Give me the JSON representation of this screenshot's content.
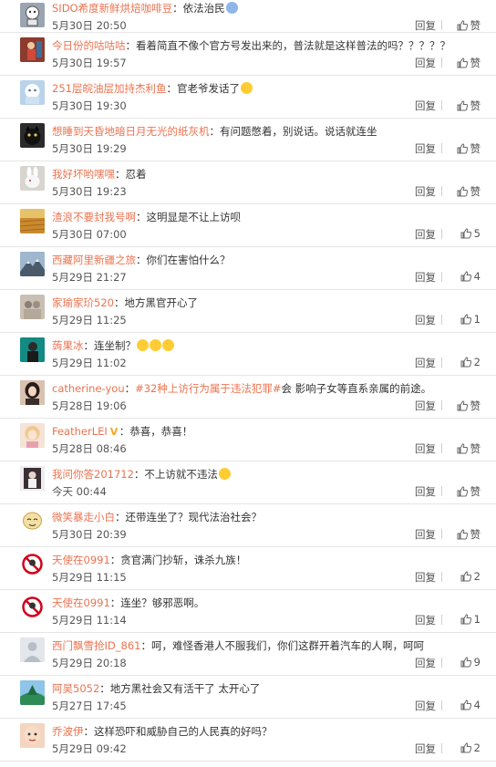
{
  "ui": {
    "reply_label": "回复",
    "like_default_label": "赞"
  },
  "comments": [
    {
      "user": "SIDO希度新鲜烘焙咖啡豆",
      "sep": "：",
      "text": "依法治民",
      "emoji": "sad",
      "time": "5月30日 20:50",
      "likes": "赞",
      "avatar": "#9aa5b1",
      "avatar_icon": "robot"
    },
    {
      "user": "今日份的咕咕咕",
      "sep": "：",
      "text": "看着简直不像个官方号发出来的，普法就是这样普法的吗？？？？？",
      "time": "5月30日 19:57",
      "likes": "赞",
      "avatar": "#c0392b",
      "avatar_icon": "figure"
    },
    {
      "user": "251层皖油层加持杰利鱼",
      "sep": "：",
      "text": "官老爷发话了",
      "emoji": "grin",
      "time": "5月30日 19:30",
      "likes": "赞",
      "avatar": "#b9d3ea",
      "avatar_icon": "ghost"
    },
    {
      "user": "想睡到天昏地暗日月无光的纸灰机",
      "sep": "：",
      "text": "有问题憋着，别说话。说话就连坐",
      "time": "5月30日 19:29",
      "likes": "赞",
      "avatar": "#2b2b2b",
      "avatar_icon": "cat"
    },
    {
      "user": "我好坏哟嘿嘿",
      "sep": "：",
      "text": "忍着",
      "time": "5月30日 19:23",
      "likes": "赞",
      "avatar": "#d8d4cf",
      "avatar_icon": "rabbit"
    },
    {
      "user": "渣浪不要封我号啊",
      "sep": "：",
      "text": "这明显是不让上访呗",
      "time": "5月30日 07:00",
      "likes": "5",
      "avatar": "#d9a441",
      "avatar_icon": "field"
    },
    {
      "user": "西藏阿里新疆之旅",
      "sep": "：",
      "text": "你们在害怕什么？",
      "time": "5月29日 21:27",
      "likes": "4",
      "avatar": "#6f8fb3",
      "avatar_icon": "mountain"
    },
    {
      "user": "家瑜家玠520",
      "sep": "：",
      "text": "地方黑官开心了",
      "time": "5月29日 11:25",
      "likes": "1",
      "avatar": "#c9bfb3",
      "avatar_icon": "people"
    },
    {
      "user": "蒟果冰",
      "sep": "：",
      "text": "连坐制？",
      "emoji3": true,
      "time": "5月29日 11:02",
      "likes": "2",
      "avatar": "#1f7f7a",
      "avatar_icon": "man"
    },
    {
      "user": "catherine-you",
      "sep": "：",
      "tag": "#32种上访行为属于违法犯罪#",
      "text": "会 影响子女等直系亲属的前途。",
      "time": "5月28日 19:06",
      "likes": "赞",
      "avatar": "#3a2e2a",
      "avatar_icon": "woman"
    },
    {
      "user": "FeatherLEI",
      "vip": true,
      "sep": "：",
      "text": "恭喜，恭喜！",
      "time": "5月28日 08:46",
      "likes": "赞",
      "avatar": "#e8c9b0",
      "avatar_icon": "girl"
    },
    {
      "user": "我问你答201712",
      "sep": "：",
      "text": "不上访就不违法",
      "emoji": "grin",
      "time": "今天 00:44",
      "likes": "赞",
      "avatar": "#5a4a55",
      "avatar_icon": "figure2"
    },
    {
      "user": "微笑暴走小白",
      "sep": "：",
      "text": "还带连坐了？现代法治社会？",
      "time": "5月30日 20:39",
      "likes": "赞",
      "avatar": "#f3e2a6",
      "avatar_icon": "cartoon"
    },
    {
      "user": "天使在0991",
      "sep": "：",
      "text": "贪官满门抄斩，诛杀九族！",
      "time": "5月29日 11:15",
      "likes": "2",
      "avatar": "#ffffff",
      "avatar_icon": "nosign"
    },
    {
      "user": "天使在0991",
      "sep": "：",
      "text": "连坐？够邪恶啊。",
      "time": "5月29日 11:14",
      "likes": "1",
      "avatar": "#ffffff",
      "avatar_icon": "nosign"
    },
    {
      "user": "西门飘雪抢ID_861",
      "sep": "：",
      "text": "呵，难怪香港人不服我们，你们这群开着汽车的人啊，呵呵",
      "time": "5月29日 20:18",
      "likes": "9",
      "avatar": "#e3e6ea",
      "avatar_icon": "default"
    },
    {
      "user": "阿昊5052",
      "sep": "：",
      "text": "地方黑社会又有活干了 太开心了",
      "time": "5月27日 17:45",
      "likes": "4",
      "avatar": "#2e8b57",
      "avatar_icon": "tree"
    },
    {
      "user": "乔波伊",
      "sep": "：",
      "text": "这样恐吓和威胁自己的人民真的好吗？",
      "time": "5月29日 09:42",
      "likes": "2",
      "avatar": "#e8b89a",
      "avatar_icon": "face"
    }
  ]
}
